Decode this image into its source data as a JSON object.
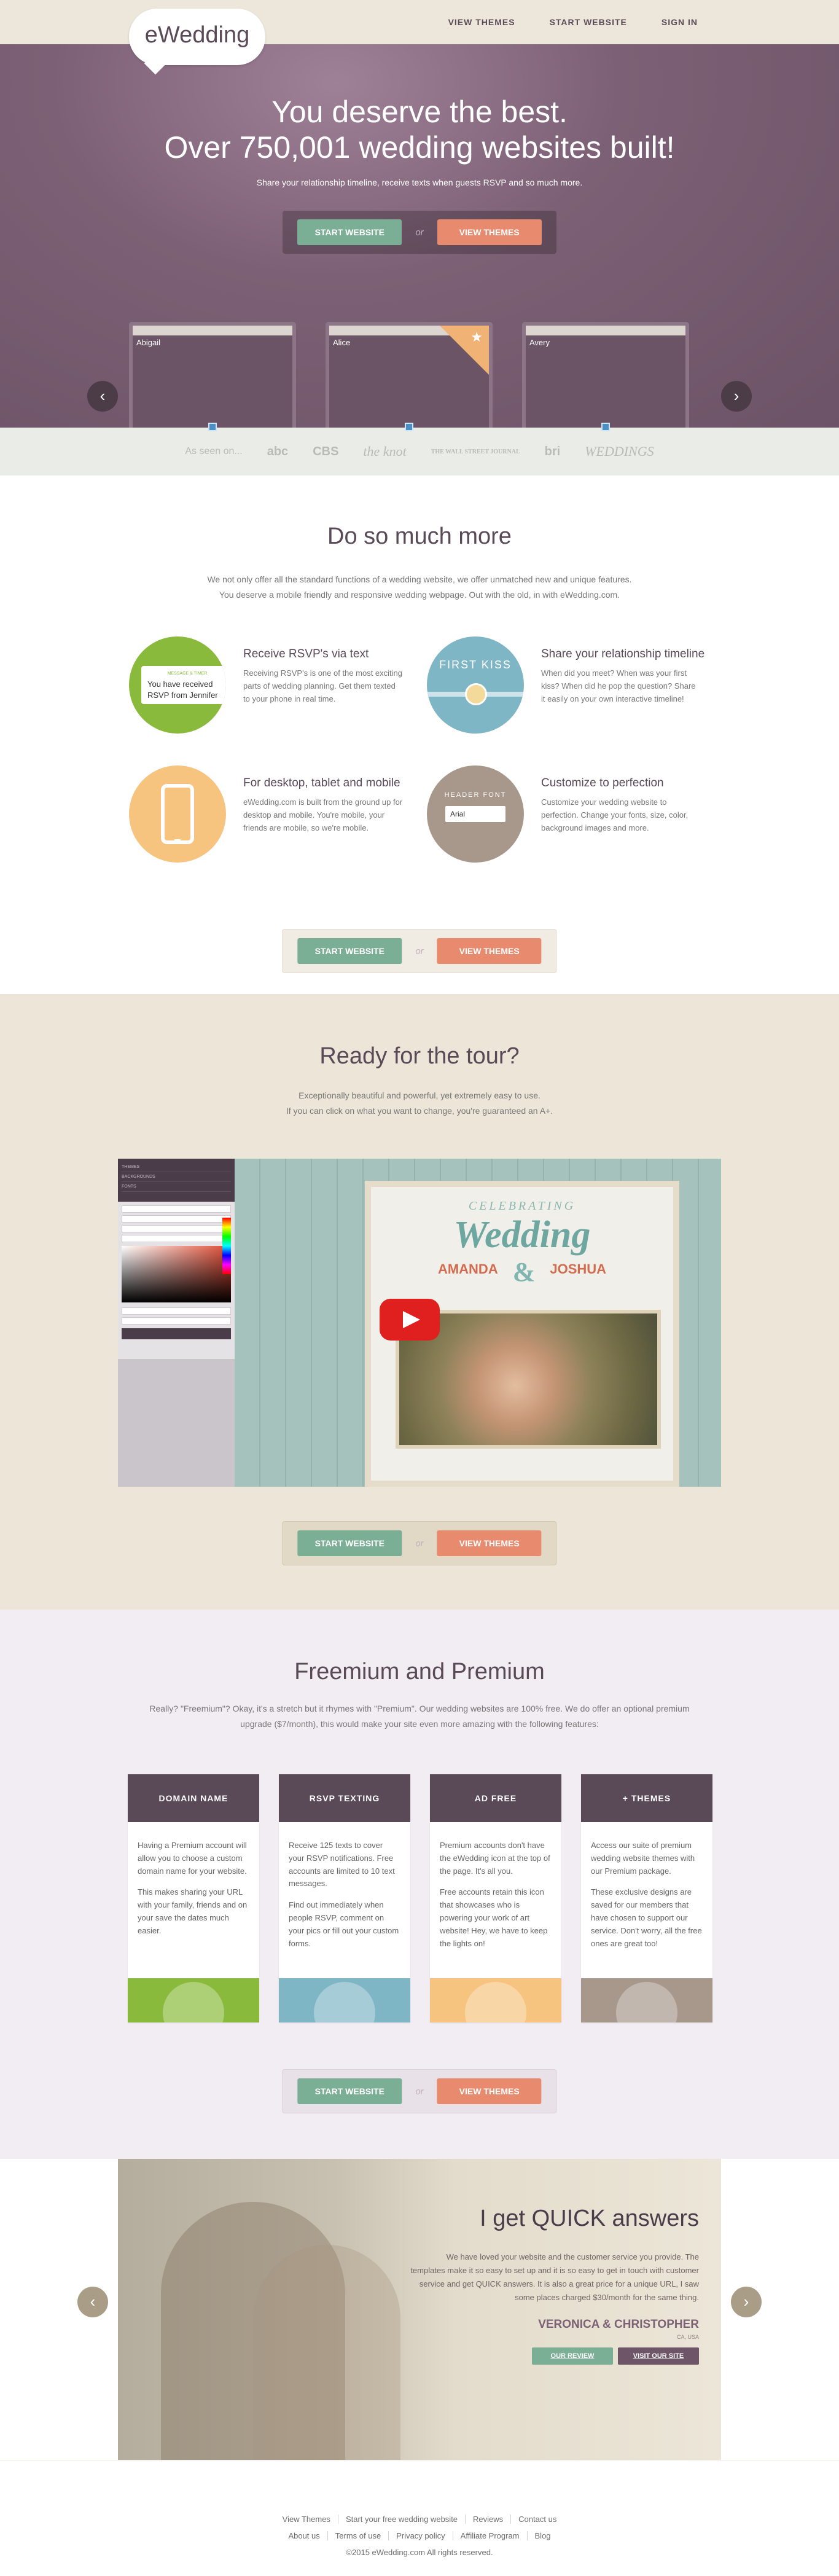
{
  "brand": {
    "logo": "eWedding"
  },
  "nav": [
    "VIEW THEMES",
    "START WEBSITE",
    "SIGN IN"
  ],
  "hero": {
    "headline1": "You deserve the best.",
    "headline2": "Over 750,001 wedding websites built!",
    "subtitle": "Share your relationship timeline, receive texts when guests RSVP and so much more."
  },
  "cta": {
    "start": "START WEBSITE",
    "or": "or",
    "themes": "VIEW THEMES"
  },
  "themes": [
    "Abigail",
    "Alice",
    "Avery"
  ],
  "seen_on": {
    "label": "As seen on...",
    "brands": [
      "abc",
      "CBS",
      "the knot",
      "THE WALL STREET JOURNAL",
      "bri",
      "WEDDINGS"
    ]
  },
  "more": {
    "title": "Do so much more",
    "lead1": "We not only offer all the standard functions of a wedding website, we offer unmatched new and unique features.",
    "lead2": "You deserve a mobile friendly and responsive wedding webpage. Out with the old, in with eWedding.com.",
    "features": [
      {
        "title": "Receive RSVP's via text",
        "text": "Receiving RSVP's is one of the most exciting parts of wedding planning. Get them texted to your phone in real time.",
        "art_tiny": "MESSAGE & TIMER",
        "art": "You have received RSVP from Jennifer"
      },
      {
        "title": "Share your relationship timeline",
        "text": "When did you meet? When was your first kiss? When did he pop the question? Share it easily on your own interactive timeline!",
        "art": "FIRST KISS"
      },
      {
        "title": "For desktop, tablet and mobile",
        "text": "eWedding.com is built from the ground up for desktop and mobile. You're mobile, your friends are mobile, so we're mobile."
      },
      {
        "title": "Customize to perfection",
        "text": "Customize your wedding website to perfection. Change your fonts, size, color, background images and more.",
        "art": "HEADER FONT",
        "art_select": "Arial"
      }
    ]
  },
  "tour": {
    "title": "Ready for the tour?",
    "lead1": "Exceptionally beautiful and powerful, yet extremely easy to use.",
    "lead2": "If you can click on what you want to change, you're guaranteed an A+.",
    "editor_items": [
      "THEMES",
      "BACKGROUNDS",
      "FONTS"
    ],
    "invite": {
      "celebrating": "CELEBRATING",
      "wedding": "Wedding",
      "name1": "AMANDA",
      "name2": "JOSHUA",
      "amp": "&"
    }
  },
  "pricing": {
    "title": "Freemium and Premium",
    "lead1": "Really? \"Freemium\"? Okay, it's a stretch but it rhymes with \"Premium\". Our wedding websites are 100% free. We do offer an optional premium",
    "lead2": "upgrade ($7/month), this would make your site even more amazing with the following features:",
    "plans": [
      {
        "title": "DOMAIN NAME",
        "p1": "Having a Premium account will allow you to choose a custom domain name for your website.",
        "p2": "This makes sharing your URL with your family, friends and on your save the dates much easier."
      },
      {
        "title": "RSVP TEXTING",
        "p1": "Receive 125 texts to cover your RSVP notifications. Free accounts are limited to 10 text messages.",
        "p2": "Find out immediately when people RSVP, comment on your pics or fill out your custom forms."
      },
      {
        "title": "AD FREE",
        "p1": "Premium accounts don't have the eWedding icon at the top of the page. It's all you.",
        "p2": "Free accounts retain this icon that showcases who is powering your work of art website! Hey, we have to keep the lights on!"
      },
      {
        "title": "+ THEMES",
        "p1": "Access our suite of premium wedding website themes with our Premium package.",
        "p2": "These exclusive designs are saved for our members that have chosen to support our service. Don't worry, all the free ones are great too!"
      }
    ]
  },
  "testimonial": {
    "title": "I get QUICK answers",
    "text": "We have loved your website and the customer service you provide. The templates make it so easy to set up and it is so easy to get in touch with customer service and get QUICK answers. It is also a great price for a unique URL, I saw some places charged $30/month for the same thing.",
    "name": "VERONICA & CHRISTOPHER",
    "location": "CA, USA",
    "btn_review": "OUR REVIEW",
    "btn_site": "VISIT OUR SITE"
  },
  "footer": {
    "row1": [
      "View Themes",
      "Start your free wedding website",
      "Reviews",
      "Contact us"
    ],
    "row2": [
      "About us",
      "Terms of use",
      "Privacy policy",
      "Affiliate Program",
      "Blog"
    ],
    "copyright": "©2015 eWedding.com All rights reserved."
  }
}
